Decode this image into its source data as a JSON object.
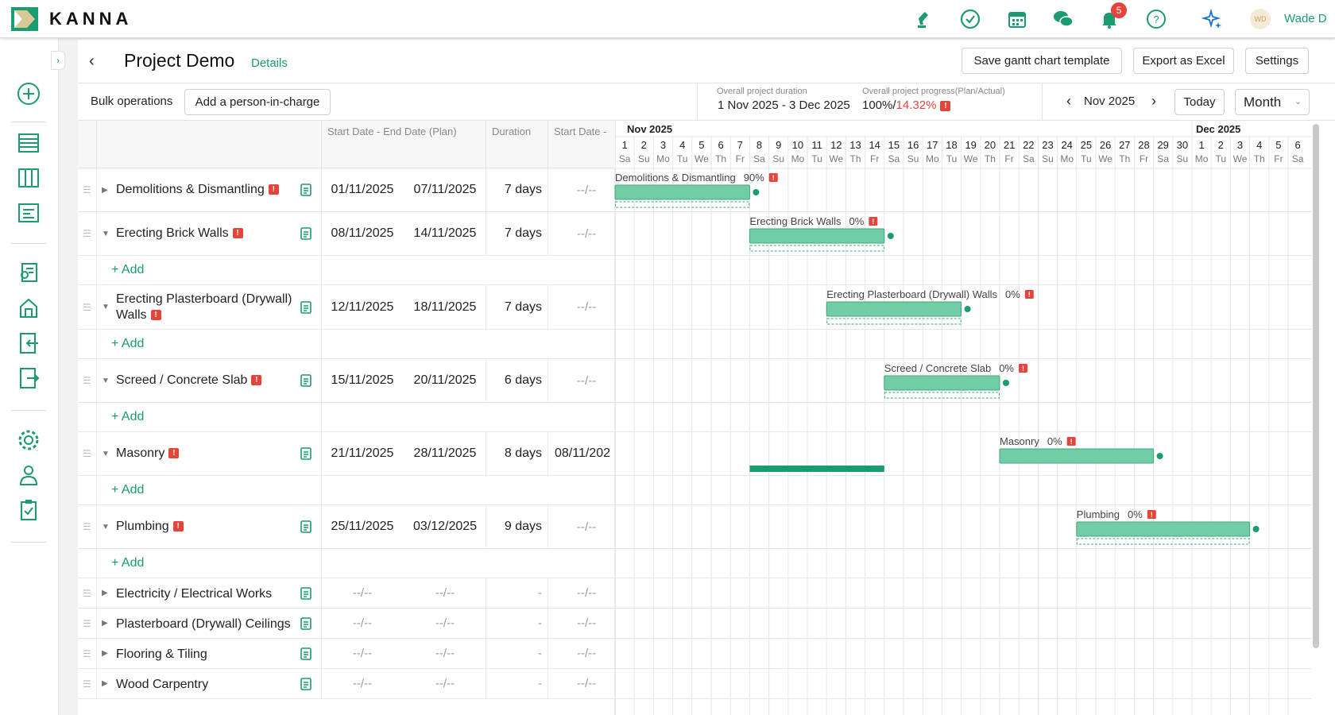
{
  "app": {
    "name": "KANNA",
    "user": "Wade D",
    "avatar_initials": "WD",
    "notifications": "5"
  },
  "top_icons": [
    "stamp-icon",
    "check-circle-icon",
    "calendar-icon",
    "chat-icon",
    "bell-icon",
    "help-icon",
    "sparkle-icon"
  ],
  "sidebar_icons": [
    "add-icon",
    "list-icon",
    "board-icon",
    "form-icon",
    "contact-icon",
    "property-icon",
    "import-icon",
    "export-icon",
    "settings-icon",
    "person-icon",
    "clipboard-icon"
  ],
  "header": {
    "title": "Project Demo",
    "details": "Details",
    "save_template": "Save gantt chart template",
    "export_excel": "Export as Excel",
    "settings": "Settings"
  },
  "subbar": {
    "bulk_ops": "Bulk operations",
    "add_person": "Add a person-in-charge",
    "duration_label": "Overall project duration",
    "duration_value": "1 Nov 2025 - 3 Dec 2025",
    "progress_label": "Overall project progress(Plan/Actual)",
    "progress_plan": "100%/",
    "progress_actual": "14.32%",
    "month_nav": "Nov 2025",
    "today": "Today",
    "view_mode": "Month"
  },
  "columns": {
    "plan": "Start Date - End Date (Plan)",
    "duration": "Duration",
    "start_actual": "Start Date -"
  },
  "calendar": {
    "month1": "Nov 2025",
    "month2": "Dec 2025",
    "days": [
      "1",
      "2",
      "3",
      "4",
      "5",
      "6",
      "7",
      "8",
      "9",
      "10",
      "11",
      "12",
      "13",
      "14",
      "15",
      "16",
      "17",
      "18",
      "19",
      "20",
      "21",
      "22",
      "23",
      "24",
      "25",
      "26",
      "27",
      "28",
      "29",
      "30",
      "1",
      "2",
      "3",
      "4",
      "5",
      "6"
    ],
    "weekdays": [
      "Sa",
      "Su",
      "Mo",
      "Tu",
      "We",
      "Th",
      "Fr",
      "Sa",
      "Su",
      "Mo",
      "Tu",
      "We",
      "Th",
      "Fr",
      "Sa",
      "Su",
      "Mo",
      "Tu",
      "We",
      "Th",
      "Fr",
      "Sa",
      "Su",
      "Mo",
      "Tu",
      "We",
      "Th",
      "Fr",
      "Sa",
      "Su",
      "Mo",
      "Tu",
      "We",
      "Th",
      "Fr",
      "Sa"
    ]
  },
  "add_label": "+ Add",
  "tasks": [
    {
      "name": "Demolitions & Dismantling",
      "warn": true,
      "expanded": false,
      "start": "01/11/2025",
      "end": "07/11/2025",
      "duration": "7 days",
      "actual": "--/--",
      "pct": "90%",
      "has_add": false,
      "bar_start": 1,
      "bar_days": 7
    },
    {
      "name": "Erecting Brick Walls",
      "warn": true,
      "expanded": true,
      "start": "08/11/2025",
      "end": "14/11/2025",
      "duration": "7 days",
      "actual": "--/--",
      "pct": "0%",
      "has_add": true,
      "bar_start": 8,
      "bar_days": 7
    },
    {
      "name": "Erecting Plasterboard (Drywall) Walls",
      "name_line1": "Erecting Plasterboard (Drywall)",
      "name_line2": "Walls",
      "warn": true,
      "expanded": true,
      "start": "12/11/2025",
      "end": "18/11/2025",
      "duration": "7 days",
      "actual": "--/--",
      "pct": "0%",
      "has_add": true,
      "bar_start": 12,
      "bar_days": 7
    },
    {
      "name": "Screed / Concrete Slab",
      "warn": true,
      "expanded": true,
      "start": "15/11/2025",
      "end": "20/11/2025",
      "duration": "6 days",
      "actual": "--/--",
      "pct": "0%",
      "has_add": true,
      "bar_start": 15,
      "bar_days": 6
    },
    {
      "name": "Masonry",
      "warn": true,
      "expanded": true,
      "start": "21/11/2025",
      "end": "28/11/2025",
      "duration": "8 days",
      "actual": "08/11/202",
      "pct": "0%",
      "has_add": true,
      "bar_start": 21,
      "bar_days": 8,
      "actual_start": 8,
      "actual_days": 7
    },
    {
      "name": "Plumbing",
      "warn": true,
      "expanded": true,
      "start": "25/11/2025",
      "end": "03/12/2025",
      "duration": "9 days",
      "actual": "--/--",
      "pct": "0%",
      "has_add": true,
      "bar_start": 25,
      "bar_days": 9
    },
    {
      "name": "Electricity / Electrical Works",
      "warn": false,
      "expanded": false,
      "start": "--/--",
      "end": "--/--",
      "duration": "-",
      "actual": "--/--",
      "has_add": false
    },
    {
      "name": "Plasterboard (Drywall) Ceilings",
      "warn": false,
      "expanded": false,
      "start": "--/--",
      "end": "--/--",
      "duration": "-",
      "actual": "--/--",
      "has_add": false
    },
    {
      "name": "Flooring & Tiling",
      "warn": false,
      "expanded": false,
      "start": "--/--",
      "end": "--/--",
      "duration": "-",
      "actual": "--/--",
      "has_add": false
    },
    {
      "name": "Wood Carpentry",
      "warn": false,
      "expanded": false,
      "start": "--/--",
      "end": "--/--",
      "duration": "-",
      "actual": "--/--",
      "has_add": false
    }
  ]
}
